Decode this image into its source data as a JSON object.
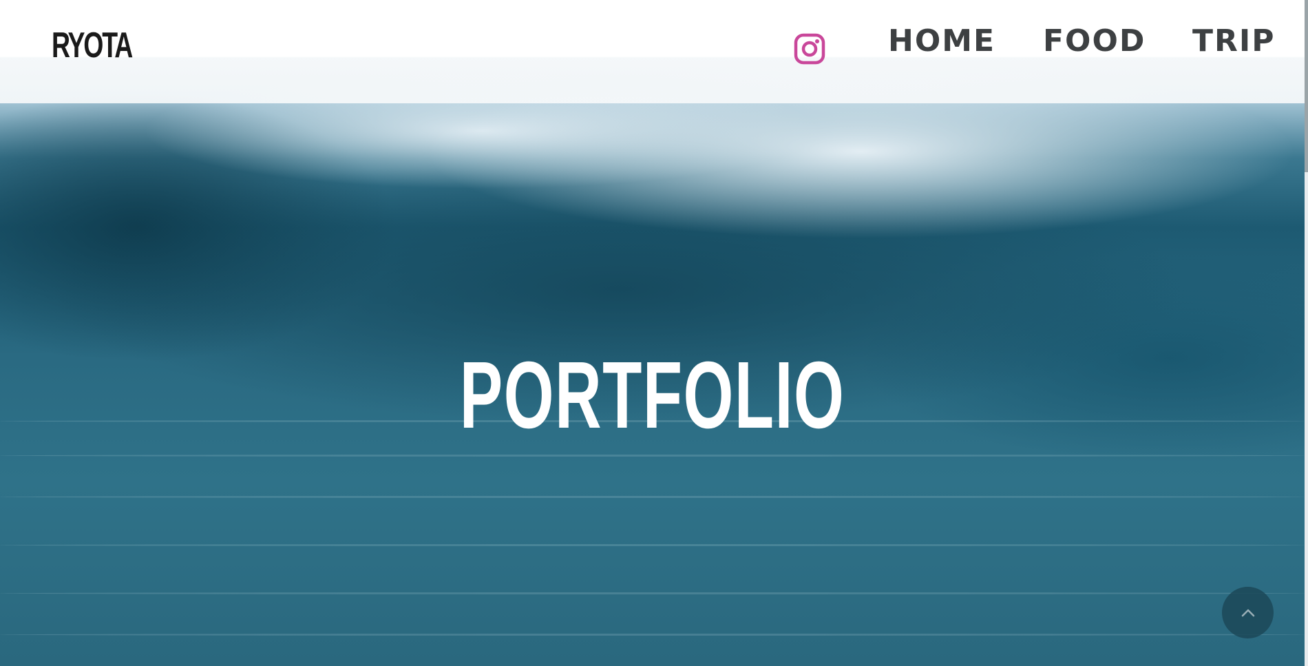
{
  "header": {
    "logo": "RYOTA",
    "instagram_icon": "instagram-icon",
    "nav": [
      {
        "label": "HOME"
      },
      {
        "label": "FOOD"
      },
      {
        "label": "TRIP"
      }
    ]
  },
  "hero": {
    "title": "PORTFOLIO"
  },
  "scroll_top": {
    "icon": "chevron-up-icon"
  },
  "colors": {
    "instagram_accent": "#c9479a",
    "nav_text": "#3d4042",
    "hero_text": "#ffffff",
    "water": "#2a6a82"
  }
}
